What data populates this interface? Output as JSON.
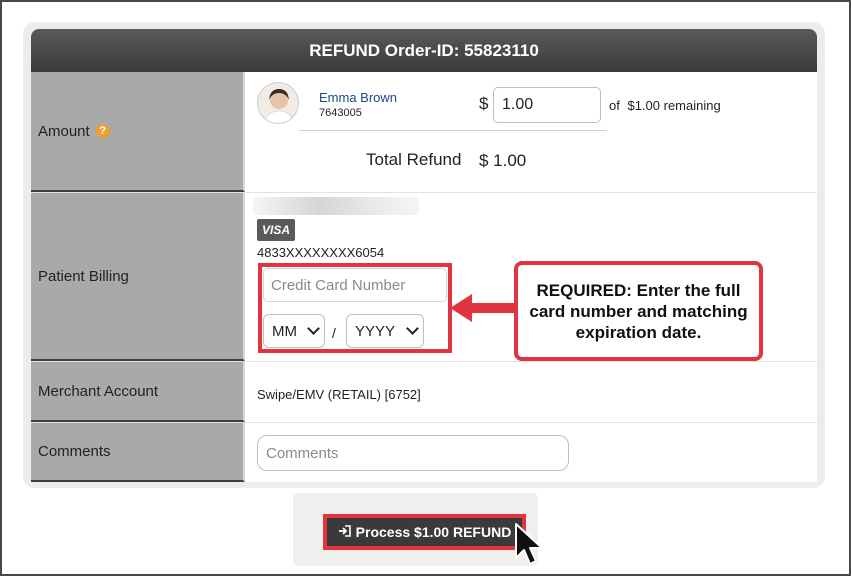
{
  "header": {
    "title": "REFUND Order-ID: 55823110"
  },
  "rows": {
    "amount": {
      "label": "Amount",
      "help_icon": "question-circle-icon",
      "patient_name": "Emma Brown",
      "patient_id": "7643005",
      "currency_symbol": "$",
      "amount_value": "1.00",
      "of_text": "of",
      "remaining_text": "$1.00 remaining",
      "total_label": "Total Refund",
      "total_value": "$ 1.00"
    },
    "patient_billing": {
      "label": "Patient Billing",
      "card_brand": "VISA",
      "card_masked": "4833XXXXXXXX6054",
      "cc_placeholder": "Credit Card Number",
      "month_selected": "MM",
      "separator": "/",
      "year_selected": "YYYY"
    },
    "merchant_account": {
      "label": "Merchant Account",
      "value": "Swipe/EMV (RETAIL) [6752]"
    },
    "comments": {
      "label": "Comments",
      "placeholder": "Comments"
    }
  },
  "callout": {
    "text": "REQUIRED: Enter the full card number and matching expiration date.",
    "color": "#e0353f"
  },
  "action": {
    "button_label": "Process $1.00 REFUND",
    "button_icon": "sign-in-icon"
  }
}
